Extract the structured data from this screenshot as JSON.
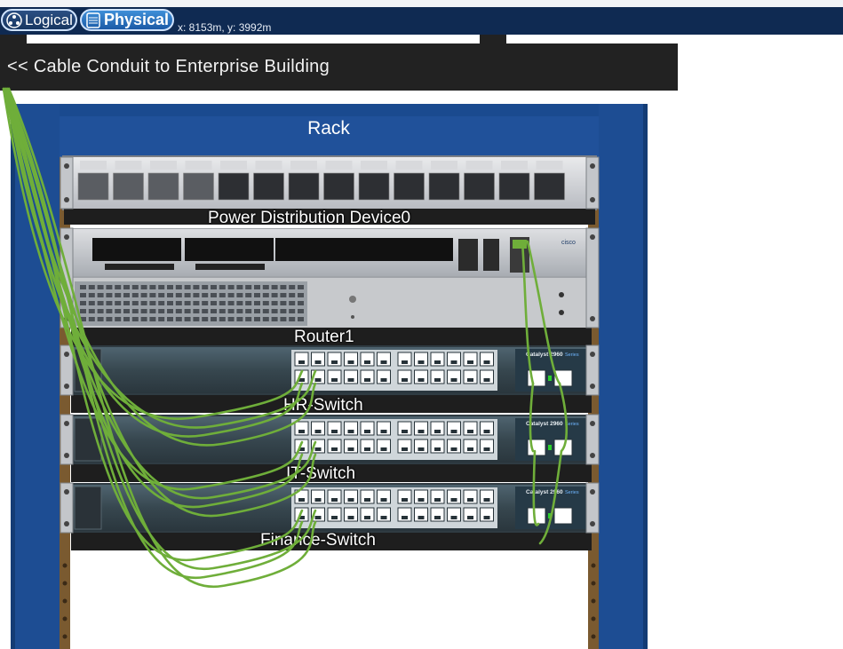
{
  "toolbar": {
    "logical_label": "Logical",
    "physical_label": "Physical",
    "coordinates": "x: 8153m, y: 3992m"
  },
  "conduit": {
    "label": "<< Cable Conduit to Enterprise Building"
  },
  "rack": {
    "title": "Rack",
    "devices": [
      {
        "name": "Power Distribution Device0"
      },
      {
        "name": "Router1"
      },
      {
        "name": "HR-Switch"
      },
      {
        "name": "IT-Switch"
      },
      {
        "name": "Finance-Switch"
      }
    ]
  },
  "switch_model": "Catalyst 2960",
  "switch_series": "Series",
  "router_brand": "cisco",
  "colors": {
    "toolbar": "#0f2a52",
    "rack_blue": "#1f4f95",
    "rack_rail": "#7a5a30",
    "cable": "#6fae3a",
    "conduit": "#222222"
  }
}
